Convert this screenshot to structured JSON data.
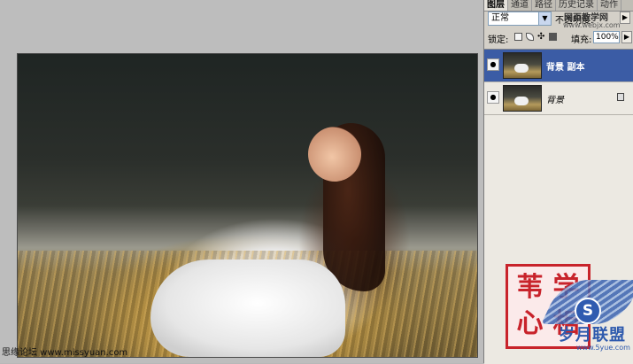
{
  "panel": {
    "tabs": [
      "图层",
      "通道",
      "路径",
      "历史记录",
      "动作"
    ],
    "blend_mode": "正常",
    "opacity_label": "不透明度:",
    "lock_label": "锁定:",
    "fill_label": "填充:",
    "fill_value": "100%",
    "layers": [
      {
        "name": "背景 副本",
        "selected": true
      },
      {
        "name": "背景",
        "selected": false
      }
    ]
  },
  "watermark": {
    "top_line1": "网页教学网",
    "top_line2": "www.webjx.com",
    "bottom_left": "思缘论坛 www.missyuan.com",
    "seal_chars": [
      "学",
      "苇",
      "相",
      "心"
    ],
    "logo_s": "S",
    "logo_text": "岁月联盟",
    "logo_url": "www.5yue.com"
  },
  "colors": {
    "selected_layer": "#3b5ca5",
    "seal_red": "#c8232b",
    "logo_blue": "#2d59ad"
  }
}
